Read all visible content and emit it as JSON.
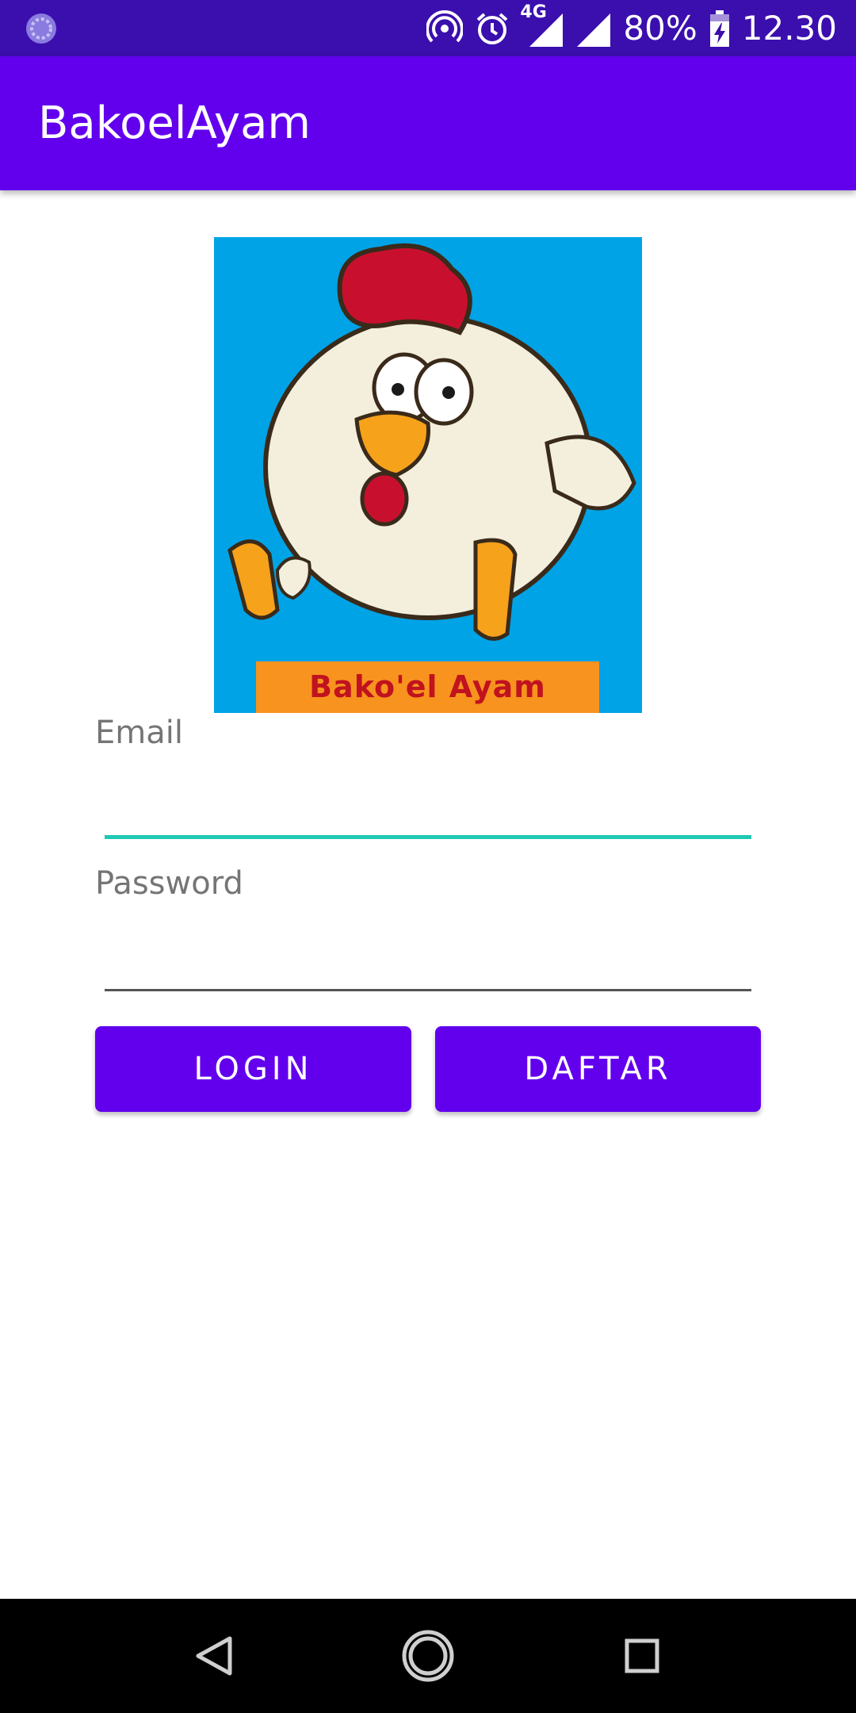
{
  "status_bar": {
    "network_type": "4G",
    "battery": "80%",
    "time": "12.30",
    "icons": [
      "hotspot-icon",
      "alarm-icon",
      "signal-4g-icon",
      "signal-icon",
      "battery-charging-icon"
    ]
  },
  "app_bar": {
    "title": "BakoelAyam",
    "color": "#6200ee"
  },
  "logo": {
    "banner_text": "Bako'el Ayam",
    "background": "#00a3e6"
  },
  "form": {
    "email_label": "Email",
    "email_value": "",
    "password_label": "Password",
    "password_value": "",
    "accent_color": "#1fc9b3"
  },
  "buttons": {
    "login_label": "LOGIN",
    "daftar_label": "DAFTAR",
    "color": "#6200ee"
  },
  "nav_bar": {
    "icons": [
      "back-icon",
      "home-icon",
      "recents-icon"
    ]
  }
}
